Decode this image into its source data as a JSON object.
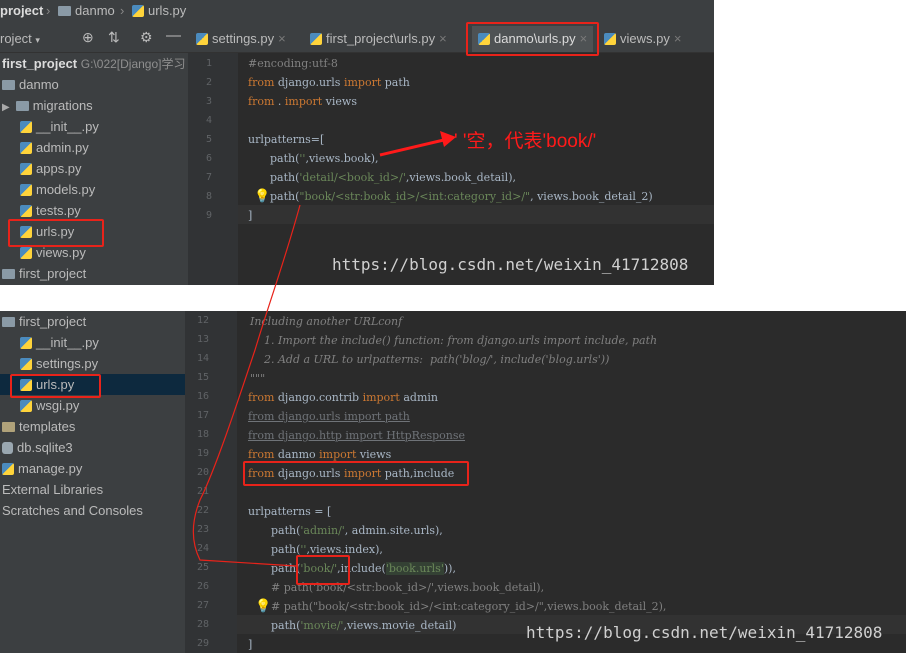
{
  "top": {
    "breadcrumb": [
      "project",
      "danmo",
      "urls.py"
    ],
    "toolbar": {
      "project_label": "roject"
    },
    "tabs": [
      {
        "label": "settings.py",
        "close": "×"
      },
      {
        "label": "first_project\\urls.py",
        "close": "×"
      },
      {
        "label": "danmo\\urls.py",
        "close": "×"
      },
      {
        "label": "views.py",
        "close": "×"
      }
    ],
    "tree": {
      "root_label": "first_project",
      "root_path": "G:\\022[Django]学习",
      "items": [
        "danmo",
        "migrations",
        "__init__.py",
        "admin.py",
        "apps.py",
        "models.py",
        "tests.py",
        "urls.py",
        "views.py",
        "first_project"
      ]
    },
    "line_numbers": [
      "1",
      "2",
      "3",
      "4",
      "5",
      "6",
      "7",
      "8",
      "9"
    ],
    "code": {
      "l1": "#encoding:utf-8",
      "l2_kw": "from",
      "l2_mod": " django.urls ",
      "l2_kw2": "import",
      "l2_name": " path",
      "l3_kw": "from",
      "l3_mid": " . ",
      "l3_kw2": "import",
      "l3_name": " views",
      "l5": "urlpatterns=[",
      "l6_pre": "path(",
      "l6_str": "''",
      "l6_post": ",views.book),",
      "l7_pre": "path(",
      "l7_str": "'detail/<book_id>/'",
      "l7_post": ",views.book_detail),",
      "l8_pre": "path(",
      "l8_str": "\"book/<str:book_id>/<int:category_id>/\"",
      "l8_post": ", views.book_detail_2)",
      "l9": "]"
    },
    "annotation": "' '空，代表'book/'",
    "watermark": "https://blog.csdn.net/weixin_41712808"
  },
  "bottom": {
    "tree": {
      "items": [
        "first_project",
        "__init__.py",
        "settings.py",
        "urls.py",
        "wsgi.py",
        "templates",
        "db.sqlite3",
        "manage.py",
        "External Libraries",
        "Scratches and Consoles"
      ]
    },
    "line_numbers": [
      "12",
      "13",
      "14",
      "15",
      "16",
      "17",
      "18",
      "19",
      "20",
      "21",
      "22",
      "23",
      "24",
      "25",
      "26",
      "27",
      "28",
      "29"
    ],
    "code": {
      "l12": "Including another URLconf",
      "l13": "    1. Import the include() function: from django.urls import include, path",
      "l14": "    2. Add a URL to urlpatterns:  path('blog/', include('blog.urls'))",
      "l15": "\"\"\"",
      "l16_kw": "from",
      "l16_mod": " django.contrib ",
      "l16_kw2": "import",
      "l16_name": " admin",
      "l17": "from django.urls import path",
      "l18": "from django.http import HttpResponse",
      "l19_kw": "from",
      "l19_mod": " danmo ",
      "l19_kw2": "import",
      "l19_name": " views",
      "l20_kw": "from",
      "l20_mod": " django.urls ",
      "l20_kw2": "import",
      "l20_name": " path,include",
      "l22": "urlpatterns = [",
      "l23_pre": "path(",
      "l23_str": "'admin/'",
      "l23_post": ", admin.site.urls),",
      "l24_pre": "path(",
      "l24_str": "''",
      "l24_post": ",views.index),",
      "l25_pre": "path(",
      "l25_str": "'book/'",
      "l25_mid": ",include(",
      "l25_str2": "'book.urls'",
      "l25_post": ")),",
      "l26": "# path('book/<str:book_id>/',views.book_detail),",
      "l27": "# path(\"book/<str:book_id>/<int:category_id>/\",views.book_detail_2),",
      "l28_pre": "path(",
      "l28_str": "'movie/'",
      "l28_post": ",views.movie_detail)",
      "l29": "]"
    },
    "watermark": "https://blog.csdn.net/weixin_41712808"
  },
  "colors": {
    "highlight_box": "#e8231a",
    "keyword": "#cc7832",
    "string": "#6a8759",
    "comment": "#808080"
  }
}
